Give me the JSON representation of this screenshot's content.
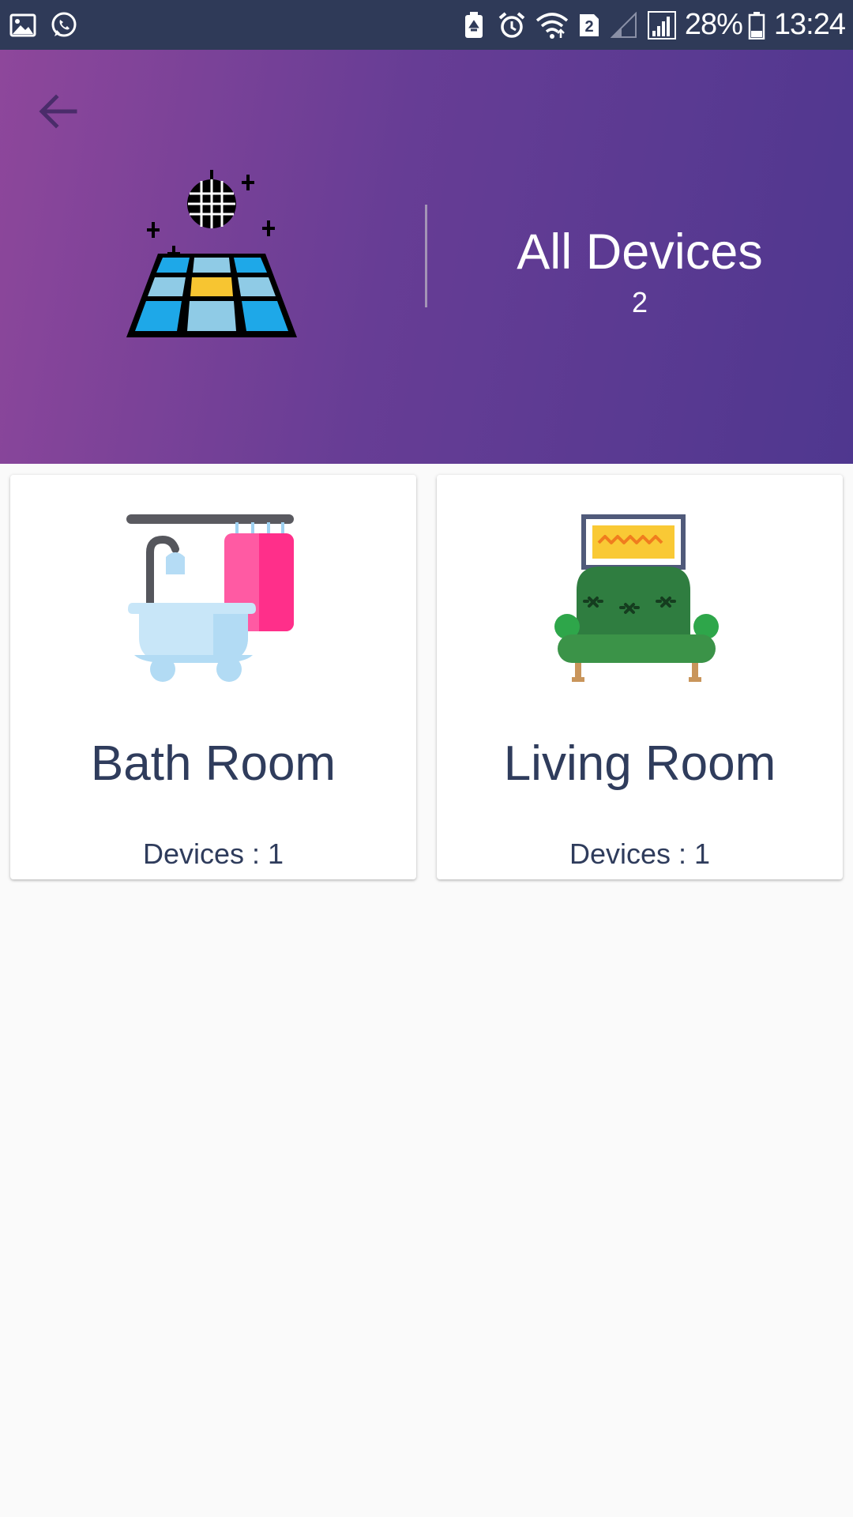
{
  "status_bar": {
    "left_icons": [
      "gallery-icon",
      "whatsapp-icon"
    ],
    "right_icons": [
      "battery-saver-icon",
      "alarm-icon",
      "wifi-icon",
      "sim2-icon",
      "signal-icon",
      "signal-icon",
      "battery-icon"
    ],
    "sim_badge": "2",
    "battery": "28%",
    "time": "13:24",
    "background": "#2f3a58"
  },
  "header": {
    "back_icon": "arrow-left-icon",
    "art_icon": "disco-floor-icon",
    "title": "All Devices",
    "count": "2",
    "gradient": [
      "#8e479b",
      "#4f378f"
    ]
  },
  "rooms": [
    {
      "name": "Bath Room",
      "devices_label": "Devices : 1",
      "icon": "bathtub-icon"
    },
    {
      "name": "Living Room",
      "devices_label": "Devices : 1",
      "icon": "sofa-icon"
    }
  ],
  "colors": {
    "text": "#2f3c5c",
    "page_bg": "#fafafa"
  }
}
